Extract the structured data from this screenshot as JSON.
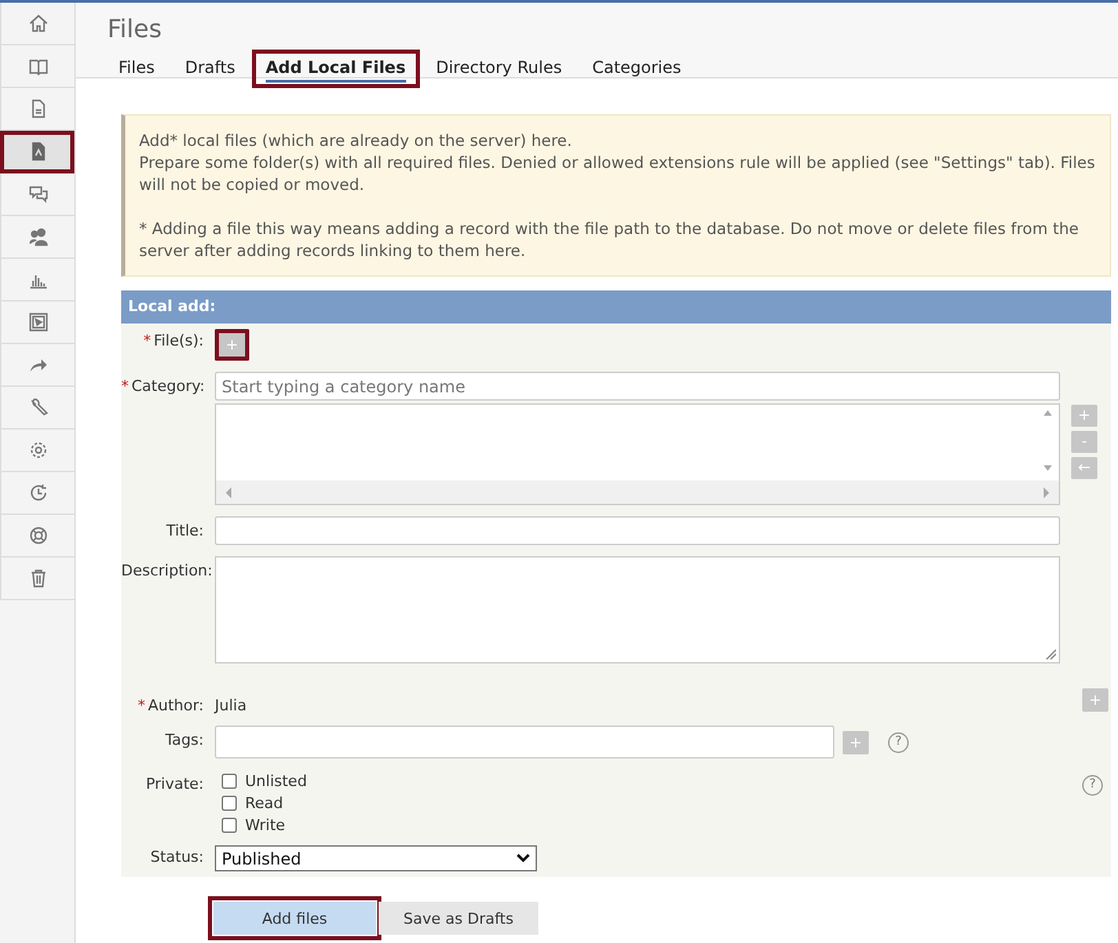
{
  "sidebar": {
    "items": [
      {
        "selected": false,
        "highlighted": false
      },
      {
        "selected": false,
        "highlighted": false
      },
      {
        "selected": false,
        "highlighted": false
      },
      {
        "selected": true,
        "highlighted": true
      },
      {
        "selected": false,
        "highlighted": false
      },
      {
        "selected": false,
        "highlighted": false
      },
      {
        "selected": false,
        "highlighted": false
      },
      {
        "selected": false,
        "highlighted": false
      },
      {
        "selected": false,
        "highlighted": false
      },
      {
        "selected": false,
        "highlighted": false
      },
      {
        "selected": false,
        "highlighted": false
      },
      {
        "selected": false,
        "highlighted": false
      },
      {
        "selected": false,
        "highlighted": false
      },
      {
        "selected": false,
        "highlighted": false
      }
    ]
  },
  "page": {
    "title": "Files"
  },
  "tabs": [
    {
      "label": "Files",
      "selected": false,
      "highlighted": false
    },
    {
      "label": "Drafts",
      "selected": false,
      "highlighted": false
    },
    {
      "label": "Add Local Files",
      "selected": true,
      "highlighted": true
    },
    {
      "label": "Directory Rules",
      "selected": false,
      "highlighted": false
    },
    {
      "label": "Categories",
      "selected": false,
      "highlighted": false
    }
  ],
  "notice": {
    "text": "Add* local files (which are already on the server) here.\nPrepare some folder(s) with all required files. Denied or allowed extensions rule will be applied (see \"Settings\" tab). Files will not be copied or moved.",
    "note": "* Adding a file this way means adding a record with the file path to the database. Do not move or delete files from the server after adding records linking to them here."
  },
  "form": {
    "title": "Local add:",
    "fields": [
      {
        "kind": "file",
        "mark": "*",
        "label": "File(s):",
        "button": "+",
        "highlighted": true
      },
      {
        "kind": "category",
        "mark": "*",
        "label": "Category:",
        "placeholder": "Start typing a category name",
        "buttons": [
          "+",
          "-",
          "←"
        ]
      },
      {
        "kind": "text",
        "label": "Title:"
      },
      {
        "kind": "textarea",
        "label": "Description:"
      },
      {
        "kind": "static",
        "mark": "*",
        "label": "Author:",
        "value": "Julia",
        "button": "+"
      },
      {
        "kind": "tags",
        "label": "Tags:",
        "button": "+",
        "help": "?"
      },
      {
        "kind": "checkboxes",
        "label": "Private:",
        "help": "?",
        "options": [
          {
            "label": "Unlisted",
            "checked": false
          },
          {
            "label": "Read",
            "checked": false
          },
          {
            "label": "Write",
            "checked": false
          }
        ]
      },
      {
        "kind": "select",
        "label": "Status:",
        "value": "Published"
      }
    ]
  },
  "buttons": [
    {
      "label": "Add files",
      "kind": "primary",
      "highlighted": true
    },
    {
      "label": "Save as Drafts",
      "kind": "secondary",
      "highlighted": false
    }
  ]
}
